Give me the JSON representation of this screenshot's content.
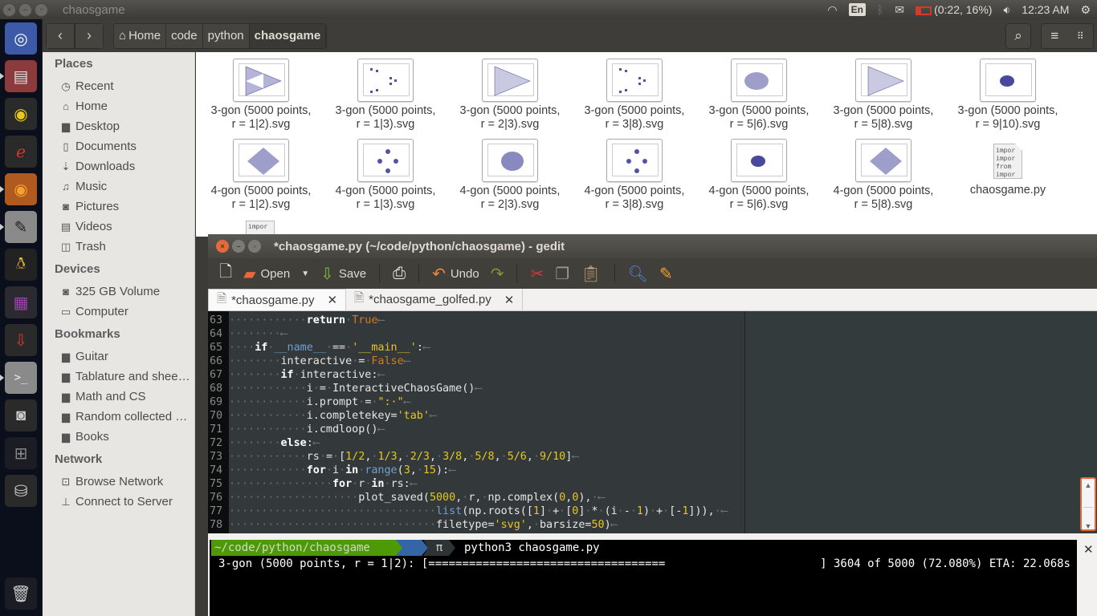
{
  "top_panel": {
    "window_title": "chaosgame",
    "keyboard_layout": "En",
    "battery": "(0:22, 16%)",
    "battery_percent": 16,
    "clock": "12:23 AM",
    "icons": [
      "wifi-icon",
      "keyboard-icon",
      "bluetooth-icon",
      "mail-icon",
      "battery-icon",
      "volume-icon",
      "power-icon"
    ]
  },
  "launcher": {
    "items": [
      {
        "name": "ubuntu-dash",
        "icon": "ubuntu-logo-icon"
      },
      {
        "name": "files",
        "icon": "file-cabinet-icon",
        "running": true
      },
      {
        "name": "rhythmbox",
        "icon": "speaker-icon"
      },
      {
        "name": "document-viewer",
        "icon": "pdf-icon"
      },
      {
        "name": "firefox",
        "icon": "firefox-icon",
        "running": true
      },
      {
        "name": "gedit",
        "icon": "text-editor-icon",
        "running": true,
        "active": true
      },
      {
        "name": "tux-guitar",
        "icon": "tux-guitar-icon"
      },
      {
        "name": "app-purple",
        "icon": "window-app-icon"
      },
      {
        "name": "software-install",
        "icon": "joystick-download-icon"
      },
      {
        "name": "terminal",
        "icon": "terminal-icon",
        "running": true
      },
      {
        "name": "shotwell",
        "icon": "camera-icon"
      },
      {
        "name": "workspace-switcher",
        "icon": "workspaces-icon"
      },
      {
        "name": "drive",
        "icon": "hard-drive-icon"
      },
      {
        "name": "trash",
        "icon": "trash-icon"
      }
    ]
  },
  "nautilus": {
    "breadcrumbs": [
      "Home",
      "code",
      "python",
      "chaosgame"
    ],
    "sidebar": {
      "places_title": "Places",
      "places": [
        {
          "label": "Recent",
          "icon": "clock-icon",
          "glyph": "◷"
        },
        {
          "label": "Home",
          "icon": "home-icon",
          "glyph": "⌂"
        },
        {
          "label": "Desktop",
          "icon": "folder-icon",
          "glyph": "▆"
        },
        {
          "label": "Documents",
          "icon": "document-icon",
          "glyph": "▯"
        },
        {
          "label": "Downloads",
          "icon": "download-icon",
          "glyph": "⇣"
        },
        {
          "label": "Music",
          "icon": "music-icon",
          "glyph": "♫"
        },
        {
          "label": "Pictures",
          "icon": "camera-icon",
          "glyph": "◙"
        },
        {
          "label": "Videos",
          "icon": "film-icon",
          "glyph": "▤"
        },
        {
          "label": "Trash",
          "icon": "trash-icon",
          "glyph": "◫"
        }
      ],
      "devices_title": "Devices",
      "devices": [
        {
          "label": "325 GB Volume",
          "icon": "drive-icon",
          "glyph": "◙"
        },
        {
          "label": "Computer",
          "icon": "computer-icon",
          "glyph": "▭"
        }
      ],
      "bookmarks_title": "Bookmarks",
      "bookmarks": [
        {
          "label": "Guitar",
          "icon": "folder-icon",
          "glyph": "▆"
        },
        {
          "label": "Tablature and shee…",
          "icon": "folder-icon",
          "glyph": "▆"
        },
        {
          "label": "Math and CS",
          "icon": "folder-icon",
          "glyph": "▆"
        },
        {
          "label": "Random collected …",
          "icon": "folder-icon",
          "glyph": "▆"
        },
        {
          "label": "Books",
          "icon": "folder-icon",
          "glyph": "▆"
        }
      ],
      "network_title": "Network",
      "network": [
        {
          "label": "Browse Network",
          "icon": "network-icon",
          "glyph": "⊡"
        },
        {
          "label": "Connect to Server",
          "icon": "server-icon",
          "glyph": "⊥"
        }
      ]
    },
    "files": [
      {
        "line1": "3-gon (5000 points,",
        "line2": "r = 1|2).svg",
        "kind": "sierpinski"
      },
      {
        "line1": "3-gon (5000 points,",
        "line2": "r = 1|3).svg",
        "kind": "clusters3"
      },
      {
        "line1": "3-gon (5000 points,",
        "line2": "r = 2|3).svg",
        "kind": "triangle-fill"
      },
      {
        "line1": "3-gon (5000 points,",
        "line2": "r = 3|8).svg",
        "kind": "clusters3"
      },
      {
        "line1": "3-gon (5000 points,",
        "line2": "r = 5|6).svg",
        "kind": "blob-tri"
      },
      {
        "line1": "3-gon (5000 points,",
        "line2": "r = 5|8).svg",
        "kind": "triangle-fill"
      },
      {
        "line1": "3-gon (5000 points,",
        "line2": "r = 9|10).svg",
        "kind": "blob-small"
      },
      {
        "line1": "4-gon (5000 points,",
        "line2": "r = 1|2).svg",
        "kind": "diamond"
      },
      {
        "line1": "4-gon (5000 points,",
        "line2": "r = 1|3).svg",
        "kind": "clusters4"
      },
      {
        "line1": "4-gon (5000 points,",
        "line2": "r = 2|3).svg",
        "kind": "blob-diamond"
      },
      {
        "line1": "4-gon (5000 points,",
        "line2": "r = 3|8).svg",
        "kind": "clusters4"
      },
      {
        "line1": "4-gon (5000 points,",
        "line2": "r = 5|6).svg",
        "kind": "blob-small"
      },
      {
        "line1": "4-gon (5000 points,",
        "line2": "r = 5|8).svg",
        "kind": "diamond"
      },
      {
        "line1": "chaosgame.py",
        "line2": "",
        "kind": "python"
      }
    ],
    "partial_file_preview": "impor",
    "python_preview": [
      "impor",
      "impor",
      "from",
      "impor"
    ]
  },
  "gedit": {
    "title": "*chaosgame.py (~/code/python/chaosgame) - gedit",
    "toolbar": {
      "new_label": "",
      "open_label": "Open",
      "save_label": "Save",
      "undo_label": "Undo"
    },
    "tabs": [
      {
        "label": "*chaosgame.py",
        "active": true
      },
      {
        "label": "*chaosgame_golfed.py",
        "active": false
      }
    ],
    "code_lines": [
      {
        "no": "63",
        "indent": 12,
        "tokens": [
          [
            "kw",
            "return"
          ],
          [
            "dot",
            "·"
          ],
          [
            "bool",
            "True"
          ]
        ]
      },
      {
        "no": "64",
        "indent": 8,
        "tokens": []
      },
      {
        "no": "65",
        "indent": 4,
        "tokens": [
          [
            "kw",
            "if"
          ],
          [
            "dot",
            "·"
          ],
          [
            "bi",
            "__name__"
          ],
          [
            "dot",
            "·"
          ],
          [
            "t",
            "=="
          ],
          [
            "dot",
            "·"
          ],
          [
            "str",
            "'__main__'"
          ],
          [
            "t",
            ":"
          ]
        ]
      },
      {
        "no": "66",
        "indent": 8,
        "tokens": [
          [
            "t",
            "interactive"
          ],
          [
            "dot",
            "·"
          ],
          [
            "t",
            "="
          ],
          [
            "dot",
            "·"
          ],
          [
            "bool",
            "False"
          ]
        ]
      },
      {
        "no": "67",
        "indent": 8,
        "tokens": [
          [
            "kw",
            "if"
          ],
          [
            "dot",
            "·"
          ],
          [
            "t",
            "interactive:"
          ]
        ]
      },
      {
        "no": "68",
        "indent": 12,
        "tokens": [
          [
            "t",
            "i"
          ],
          [
            "dot",
            "·"
          ],
          [
            "t",
            "="
          ],
          [
            "dot",
            "·"
          ],
          [
            "t",
            "InteractiveChaosGame()"
          ]
        ]
      },
      {
        "no": "69",
        "indent": 12,
        "tokens": [
          [
            "t",
            "i.prompt"
          ],
          [
            "dot",
            "·"
          ],
          [
            "t",
            "="
          ],
          [
            "dot",
            "·"
          ],
          [
            "str",
            "\":·\""
          ]
        ]
      },
      {
        "no": "70",
        "indent": 12,
        "tokens": [
          [
            "t",
            "i.completekey="
          ],
          [
            "str",
            "'tab'"
          ]
        ]
      },
      {
        "no": "71",
        "indent": 12,
        "tokens": [
          [
            "t",
            "i.cmdloop()"
          ]
        ]
      },
      {
        "no": "72",
        "indent": 8,
        "tokens": [
          [
            "kw",
            "else"
          ],
          [
            "t",
            ":"
          ]
        ]
      },
      {
        "no": "73",
        "indent": 12,
        "tokens": [
          [
            "t",
            "rs"
          ],
          [
            "dot",
            "·"
          ],
          [
            "t",
            "="
          ],
          [
            "dot",
            "·"
          ],
          [
            "t",
            "["
          ],
          [
            "num",
            "1/2"
          ],
          [
            "t",
            ","
          ],
          [
            "dot",
            "·"
          ],
          [
            "num",
            "1/3"
          ],
          [
            "t",
            ","
          ],
          [
            "dot",
            "·"
          ],
          [
            "num",
            "2/3"
          ],
          [
            "t",
            ","
          ],
          [
            "dot",
            "·"
          ],
          [
            "num",
            "3/8"
          ],
          [
            "t",
            ","
          ],
          [
            "dot",
            "·"
          ],
          [
            "num",
            "5/8"
          ],
          [
            "t",
            ","
          ],
          [
            "dot",
            "·"
          ],
          [
            "num",
            "5/6"
          ],
          [
            "t",
            ","
          ],
          [
            "dot",
            "·"
          ],
          [
            "num",
            "9/10"
          ],
          [
            "t",
            "]"
          ]
        ]
      },
      {
        "no": "74",
        "indent": 12,
        "tokens": [
          [
            "kw",
            "for"
          ],
          [
            "dot",
            "·"
          ],
          [
            "t",
            "i"
          ],
          [
            "dot",
            "·"
          ],
          [
            "kw",
            "in"
          ],
          [
            "dot",
            "·"
          ],
          [
            "bi",
            "range"
          ],
          [
            "t",
            "("
          ],
          [
            "num",
            "3"
          ],
          [
            "t",
            ","
          ],
          [
            "dot",
            "·"
          ],
          [
            "num",
            "15"
          ],
          [
            "t",
            "):"
          ]
        ]
      },
      {
        "no": "75",
        "indent": 16,
        "tokens": [
          [
            "kw",
            "for"
          ],
          [
            "dot",
            "·"
          ],
          [
            "t",
            "r"
          ],
          [
            "dot",
            "·"
          ],
          [
            "kw",
            "in"
          ],
          [
            "dot",
            "·"
          ],
          [
            "t",
            "rs:"
          ]
        ]
      },
      {
        "no": "76",
        "indent": 20,
        "tokens": [
          [
            "t",
            "plot_saved("
          ],
          [
            "num",
            "5000"
          ],
          [
            "t",
            ","
          ],
          [
            "dot",
            "·"
          ],
          [
            "t",
            "r,"
          ],
          [
            "dot",
            "·"
          ],
          [
            "t",
            "np.complex("
          ],
          [
            "num",
            "0"
          ],
          [
            "t",
            ","
          ],
          [
            "num",
            "0"
          ],
          [
            "t",
            "),"
          ],
          [
            "dot",
            "·"
          ]
        ]
      },
      {
        "no": "77",
        "indent": 32,
        "tokens": [
          [
            "bi",
            "list"
          ],
          [
            "t",
            "(np.roots(["
          ],
          [
            "num",
            "1"
          ],
          [
            "t",
            "]"
          ],
          [
            "dot",
            "·"
          ],
          [
            "t",
            "+"
          ],
          [
            "dot",
            "·"
          ],
          [
            "t",
            "["
          ],
          [
            "num",
            "0"
          ],
          [
            "t",
            "]"
          ],
          [
            "dot",
            "·"
          ],
          [
            "t",
            "*"
          ],
          [
            "dot",
            "·"
          ],
          [
            "t",
            "(i"
          ],
          [
            "dot",
            "·"
          ],
          [
            "t",
            "-"
          ],
          [
            "dot",
            "·"
          ],
          [
            "num",
            "1"
          ],
          [
            "t",
            ")"
          ],
          [
            "dot",
            "·"
          ],
          [
            "t",
            "+"
          ],
          [
            "dot",
            "·"
          ],
          [
            "t",
            "[-"
          ],
          [
            "num",
            "1"
          ],
          [
            "t",
            "])),"
          ],
          [
            "dot",
            "·"
          ]
        ]
      },
      {
        "no": "78",
        "indent": 32,
        "tokens": [
          [
            "t",
            "filetype="
          ],
          [
            "str",
            "'svg'"
          ],
          [
            "t",
            ","
          ],
          [
            "dot",
            "·"
          ],
          [
            "t",
            "barsize="
          ],
          [
            "num",
            "50"
          ],
          [
            "t",
            ")"
          ]
        ]
      }
    ]
  },
  "terminal": {
    "prompt_path": "~/code/python/chaosgame",
    "prompt_symbol": "π",
    "command": "python3 chaosgame.py",
    "progress_label": "3-gon (5000 points, r = 1|2): [",
    "progress_bar": "===================================",
    "progress_status": "] 3604 of 5000 (72.080%) ETA: 22.068s",
    "progress_fraction": 0.7208,
    "colors": {
      "path_bg": "#4e9a06",
      "arrow_bg": "#3465a4",
      "symbol_bg": "#2e3436"
    }
  }
}
